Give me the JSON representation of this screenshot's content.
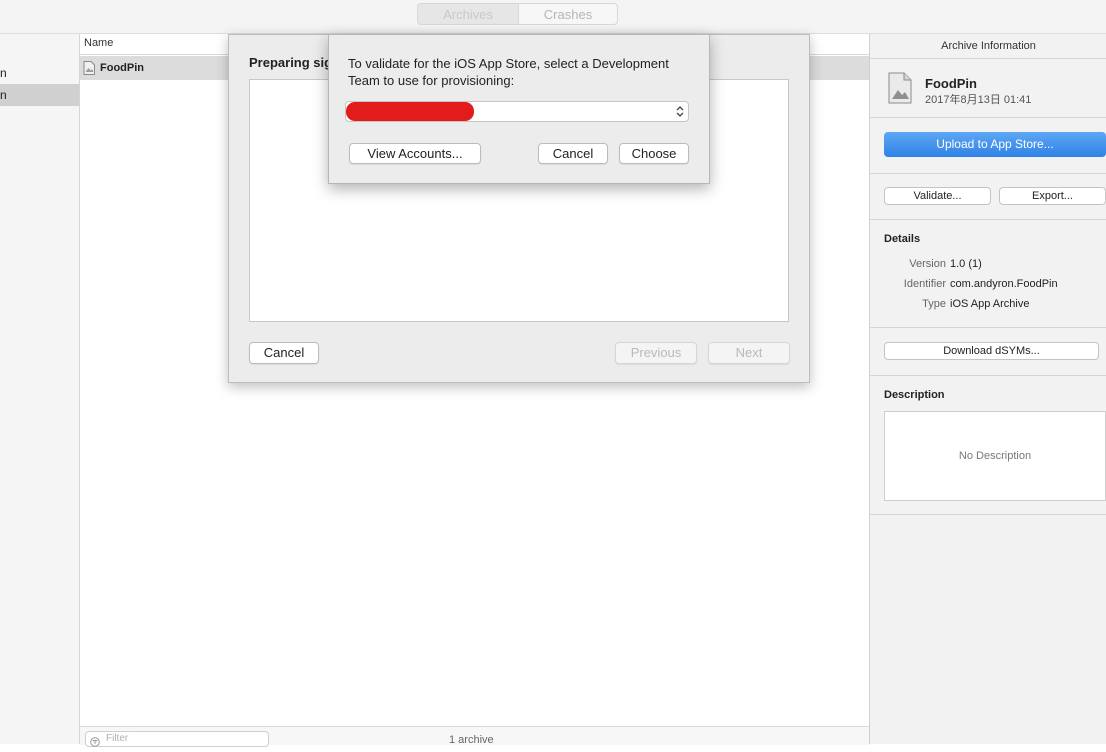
{
  "top_tabs": {
    "archives": "Archives",
    "crashes": "Crashes"
  },
  "sidebar": {
    "items": [
      "n",
      "n"
    ]
  },
  "list": {
    "header_name": "Name",
    "rows": [
      {
        "name": "FoodPin"
      }
    ],
    "filter_placeholder": "Filter",
    "status": "1 archive"
  },
  "sheet": {
    "title": "Preparing sig",
    "cancel": "Cancel",
    "previous": "Previous",
    "next": "Next"
  },
  "popup": {
    "message": "To validate for the iOS App Store, select a Development Team to use for provisioning:",
    "selected_team": "",
    "redaction_color": "#e21b1b",
    "view_accounts": "View Accounts...",
    "cancel": "Cancel",
    "choose": "Choose"
  },
  "right_panel": {
    "title": "Archive Information",
    "app_name": "FoodPin",
    "date": "2017年8月13日 01:41",
    "upload": "Upload to App Store...",
    "validate": "Validate...",
    "export": "Export...",
    "details_heading": "Details",
    "details": [
      {
        "label": "Version",
        "value": "1.0 (1)"
      },
      {
        "label": "Identifier",
        "value": "com.andyron.FoodPin"
      },
      {
        "label": "Type",
        "value": "iOS App Archive"
      }
    ],
    "download_dsyms": "Download dSYMs...",
    "description_heading": "Description",
    "description_placeholder": "No Description"
  },
  "colors": {
    "accent": "#4a90e2",
    "accent_dark": "#2f7ee0"
  }
}
